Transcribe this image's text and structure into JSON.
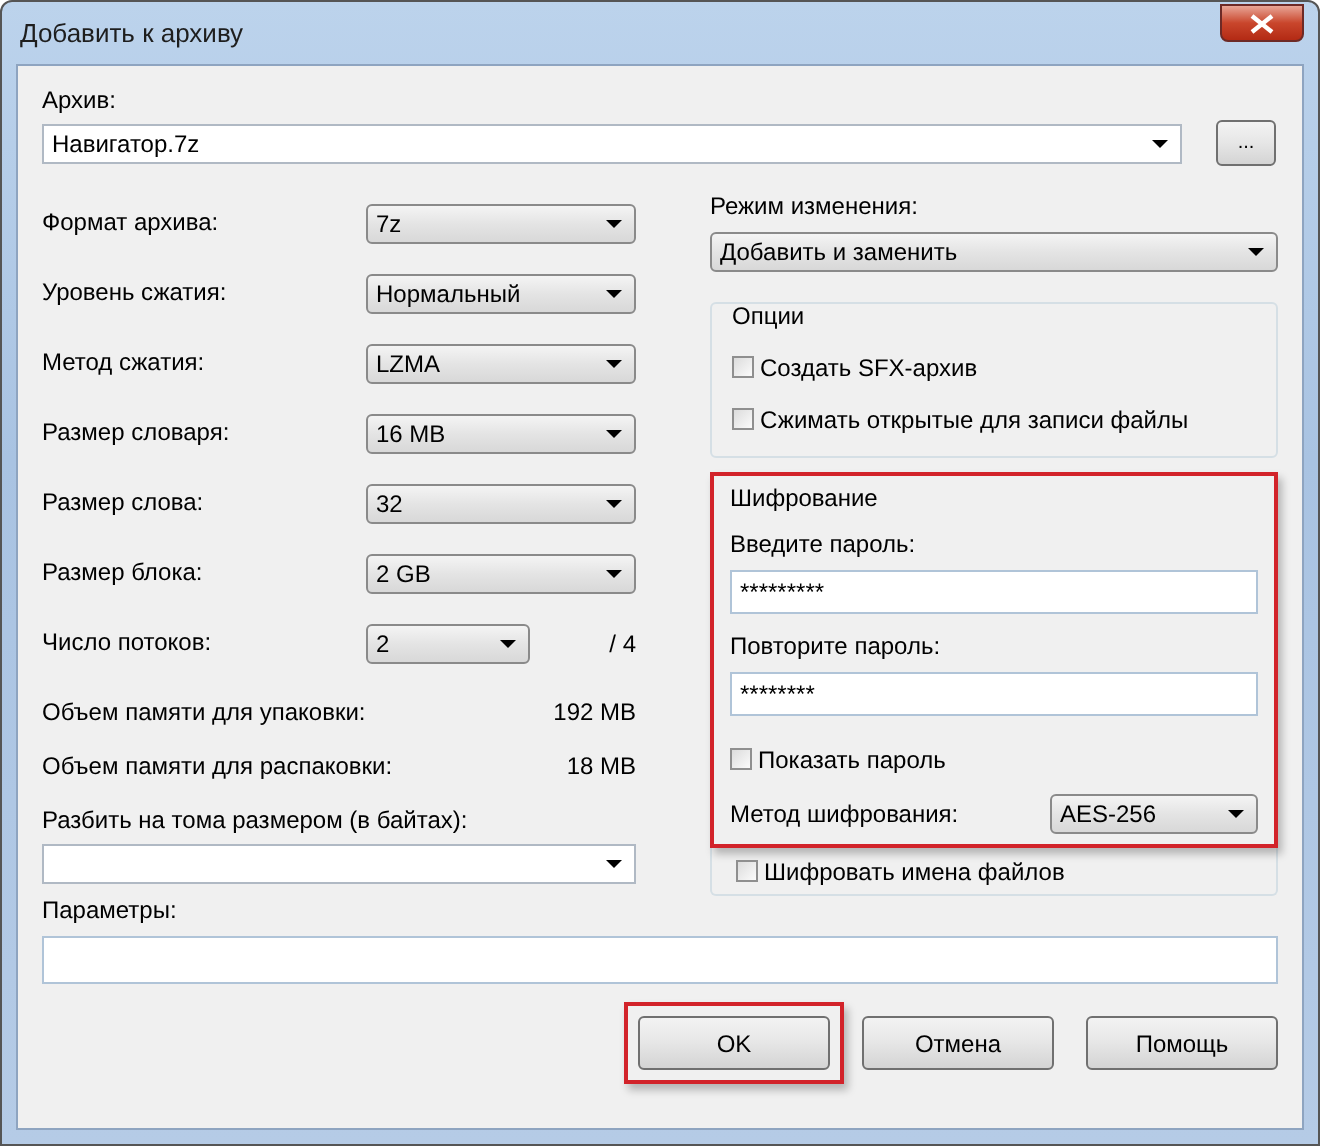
{
  "window": {
    "title": "Добавить к архиву"
  },
  "archive": {
    "label": "Архив:",
    "value": "Навигатор.7z",
    "browse": "..."
  },
  "settings": [
    {
      "kind": "select",
      "label": "Формат архива:",
      "value": "7z"
    },
    {
      "kind": "select",
      "label": "Уровень сжатия:",
      "value": "Нормальный"
    },
    {
      "kind": "select",
      "label": "Метод сжатия:",
      "value": "LZMA"
    },
    {
      "kind": "select",
      "label": "Размер словаря:",
      "value": "16 MB"
    },
    {
      "kind": "select",
      "label": "Размер слова:",
      "value": "32"
    },
    {
      "kind": "select",
      "label": "Размер блока:",
      "value": "2 GB"
    },
    {
      "kind": "short-select",
      "label": "Число потоков:",
      "value": "2",
      "suffix": "/ 4"
    }
  ],
  "memory": [
    {
      "label": "Объем памяти для упаковки:",
      "value": "192 MB"
    },
    {
      "label": "Объем памяти для распаковки:",
      "value": "18 MB"
    }
  ],
  "split": {
    "label": "Разбить на тома размером (в байтах):"
  },
  "params": {
    "label": "Параметры:"
  },
  "update_mode": {
    "label": "Режим изменения:",
    "value": "Добавить и заменить"
  },
  "options": {
    "title": "Опции",
    "items": [
      {
        "label": "Создать SFX-архив",
        "checked": false
      },
      {
        "label": "Сжимать открытые для записи файлы",
        "checked": false
      }
    ]
  },
  "encryption": {
    "title": "Шифрование",
    "highlighted": true,
    "password_label": "Введите пароль:",
    "password": "*********",
    "repeat_label": "Повторите пароль:",
    "repeat": "********",
    "show_password": {
      "label": "Показать пароль",
      "checked": false
    },
    "method_label": "Метод шифрования:",
    "method": "AES-256",
    "encrypt_names": {
      "label": "Шифровать имена файлов",
      "checked": false
    }
  },
  "buttons": [
    {
      "label": "OK",
      "highlighted": true
    },
    {
      "label": "Отмена",
      "highlighted": false
    },
    {
      "label": "Помощь",
      "highlighted": false
    }
  ]
}
